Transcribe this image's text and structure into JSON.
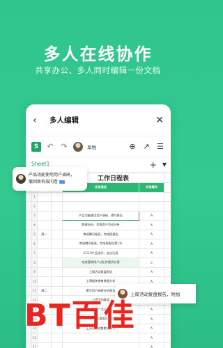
{
  "promo": {
    "headline": "多人在线协作",
    "subline": "共享办公、多人同时编辑一份文档"
  },
  "phone": {
    "nav": {
      "back_icon": "‹",
      "title": "多人编辑",
      "close_icon": "✕"
    },
    "toolbar": {
      "logo": "S",
      "user_name": "早悦"
    },
    "sheet": {
      "tab": "Sheet1"
    },
    "spreadsheet": {
      "title": "工作日程表",
      "header_cells": [
        "任务描述",
        "任务编号"
      ],
      "rows": [
        {
          "num": "1",
          "group": "",
          "task": "",
          "code": ""
        },
        {
          "num": "2",
          "group": "",
          "task": "",
          "code": ""
        },
        {
          "num": "3",
          "group": "",
          "task": "产品功能使用用户调研，撰写报告",
          "code": "A"
        },
        {
          "num": "4",
          "group": "",
          "task": "数据分析，本周用户活动分析",
          "code": "A"
        },
        {
          "num": "5",
          "group": "周一",
          "task": "审阅腾讯报表，完成周报告",
          "code": "A"
        },
        {
          "num": "6",
          "group": "",
          "task": "审阅腾讯报表，完成周报告第1节",
          "code": "A"
        },
        {
          "num": "7",
          "group": "",
          "task": "V12.0产品迭代，会议记录",
          "code": "A"
        },
        {
          "num": "8",
          "group": "",
          "task": "完成营销用户分析并提供方案",
          "code": "C"
        },
        {
          "num": "9",
          "group": "",
          "task": "上周活动复盘报告",
          "code": "A"
        },
        {
          "num": "10",
          "group": "",
          "task": "上周相关销售数据分析",
          "code": "A"
        },
        {
          "num": "11",
          "group": "周二",
          "task": "撰写用户调研分析报告",
          "code": "A"
        },
        {
          "num": "12",
          "group": "",
          "task": "上周活动复盘",
          "code": "A"
        },
        {
          "num": "13",
          "group": "",
          "task": "品牌推广活动策划",
          "code": "A"
        },
        {
          "num": "14",
          "group": "",
          "task": "上周活动复盘报告，附加",
          "code": "A"
        },
        {
          "num": "15",
          "group": "",
          "task": "上周相关销售数据分析",
          "code": "A"
        },
        {
          "num": "16",
          "group": "",
          "task": "",
          "code": "A"
        },
        {
          "num": "17",
          "group": "",
          "task": "",
          "code": "A"
        },
        {
          "num": "18",
          "group": "",
          "task": "",
          "code": "A"
        }
      ]
    }
  },
  "bubbles": {
    "left": {
      "line1": "产品功能使用用户调研，",
      "line2": "撤回收有效问卷"
    },
    "right": {
      "text": "上周活动复盘报告，附加"
    }
  },
  "watermark": {
    "text": "BT百佳"
  },
  "colors": {
    "accent": "#2fc58c",
    "sheet_green": "#21a366",
    "watermark_red": "#e8251f"
  }
}
